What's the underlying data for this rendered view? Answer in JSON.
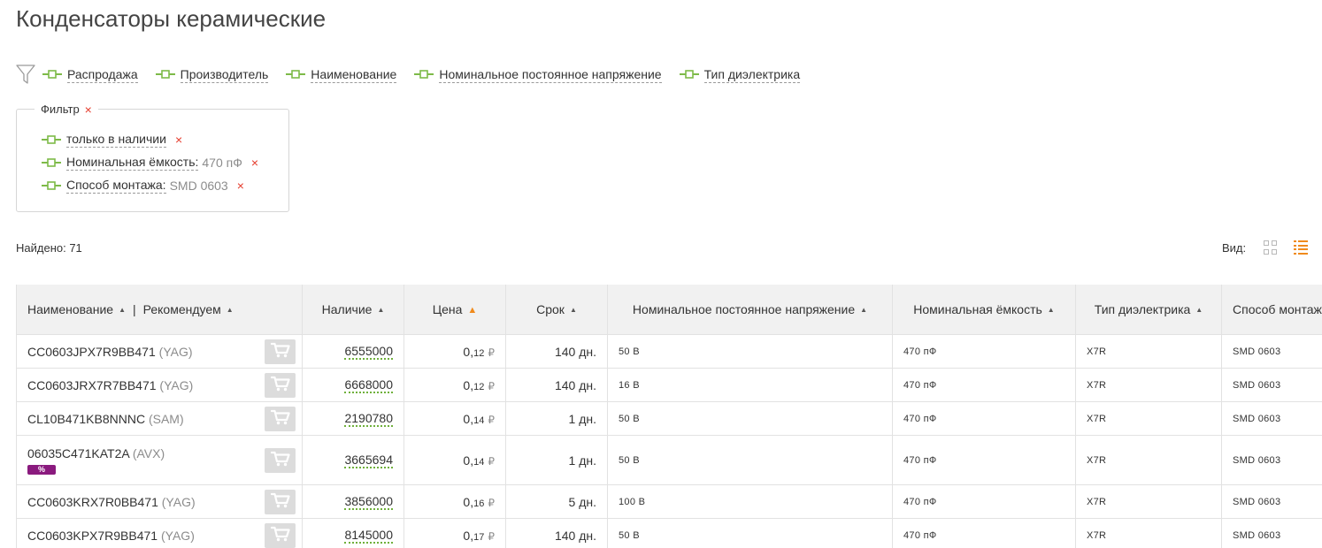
{
  "page": {
    "title": "Конденсаторы керамические"
  },
  "filter_bar": {
    "items": [
      {
        "label": "Распродажа"
      },
      {
        "label": "Производитель"
      },
      {
        "label": "Наименование"
      },
      {
        "label": "Номинальное постоянное напряжение"
      },
      {
        "label": "Тип диэлектрика"
      }
    ]
  },
  "filter_box": {
    "legend": "Фильтр",
    "remove_symbol": "×",
    "rows": [
      {
        "label": "только в наличии",
        "value": ""
      },
      {
        "label": "Номинальная ёмкость:",
        "value": "470 пФ"
      },
      {
        "label": "Способ монтажа:",
        "value": "SMD 0603"
      }
    ]
  },
  "results": {
    "found_text": "Найдено: 71"
  },
  "view": {
    "label": "Вид:",
    "mode": "list"
  },
  "table": {
    "headers": {
      "name": "Наименование",
      "separator": "|",
      "recommended": "Рекомендуем",
      "stock": "Наличие",
      "price": "Цена",
      "term": "Срок",
      "voltage": "Номинальное постоянное напряжение",
      "capacitance": "Номинальная ёмкость",
      "dielectric": "Тип диэлектрика",
      "mounting": "Способ монтажа"
    },
    "sort_arrow": "▲",
    "rows": [
      {
        "name": "CC0603JPX7R9BB471",
        "brand": "(YAG)",
        "promo": "",
        "stock": "6555000",
        "price_int": "0,",
        "price_dec": "12",
        "currency": "₽",
        "term": "140 дн.",
        "voltage": "50 В",
        "capacitance": "470 пФ",
        "dielectric": "X7R",
        "mounting": "SMD 0603"
      },
      {
        "name": "CC0603JRX7R7BB471",
        "brand": "(YAG)",
        "promo": "",
        "stock": "6668000",
        "price_int": "0,",
        "price_dec": "12",
        "currency": "₽",
        "term": "140 дн.",
        "voltage": "16 В",
        "capacitance": "470 пФ",
        "dielectric": "X7R",
        "mounting": "SMD 0603"
      },
      {
        "name": "CL10B471KB8NNNC",
        "brand": "(SAM)",
        "promo": "",
        "stock": "2190780",
        "price_int": "0,",
        "price_dec": "14",
        "currency": "₽",
        "term": "1 дн.",
        "voltage": "50 В",
        "capacitance": "470 пФ",
        "dielectric": "X7R",
        "mounting": "SMD 0603"
      },
      {
        "name": "06035C471KAT2A",
        "brand": "(AVX)",
        "promo": "%",
        "stock": "3665694",
        "price_int": "0,",
        "price_dec": "14",
        "currency": "₽",
        "term": "1 дн.",
        "voltage": "50 В",
        "capacitance": "470 пФ",
        "dielectric": "X7R",
        "mounting": "SMD 0603"
      },
      {
        "name": "CC0603KRX7R0BB471",
        "brand": "(YAG)",
        "promo": "",
        "stock": "3856000",
        "price_int": "0,",
        "price_dec": "16",
        "currency": "₽",
        "term": "5 дн.",
        "voltage": "100 В",
        "capacitance": "470 пФ",
        "dielectric": "X7R",
        "mounting": "SMD 0603"
      },
      {
        "name": "CC0603KPX7R9BB471",
        "brand": "(YAG)",
        "promo": "",
        "stock": "8145000",
        "price_int": "0,",
        "price_dec": "17",
        "currency": "₽",
        "term": "140 дн.",
        "voltage": "50 В",
        "capacitance": "470 пФ",
        "dielectric": "X7R",
        "mounting": "SMD 0603"
      }
    ]
  },
  "colors": {
    "accent": "#f08a1c",
    "slider_green": "#7dba48",
    "remove_red": "#e53b2c",
    "promo_purple": "#8a1a7e"
  }
}
